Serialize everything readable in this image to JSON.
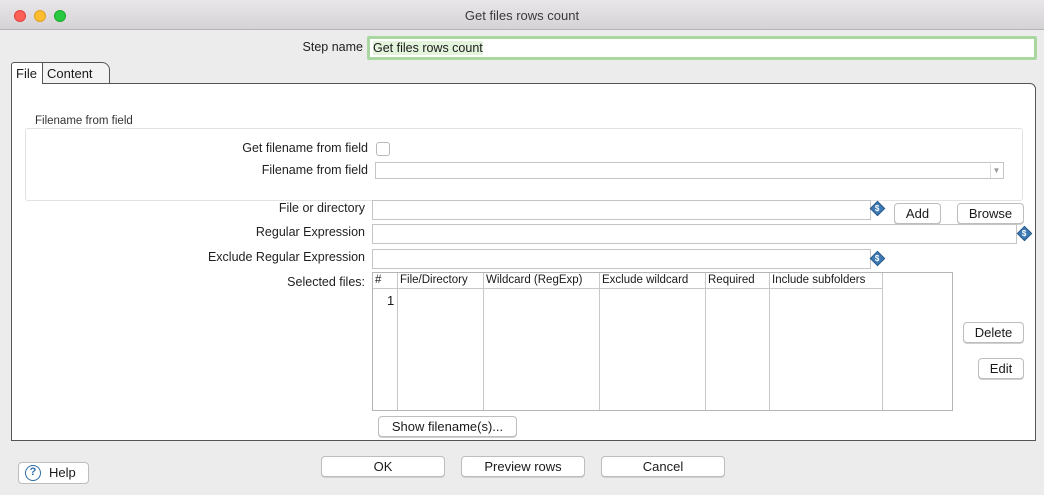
{
  "window": {
    "title": "Get files rows count"
  },
  "step": {
    "label": "Step name",
    "value": "Get files rows count"
  },
  "tabs": [
    {
      "label": "File"
    },
    {
      "label": "Content"
    }
  ],
  "filename_from_field": {
    "group_title": "Filename from field",
    "get_filename_label": "Get filename from field",
    "get_filename_checked": false,
    "filename_field_label": "Filename from field",
    "filename_field_value": ""
  },
  "file": {
    "file_or_directory_label": "File or directory",
    "file_or_directory_value": "",
    "regex_label": "Regular Expression",
    "regex_value": "",
    "exclude_regex_label": "Exclude Regular Expression",
    "exclude_regex_value": "",
    "add_label": "Add",
    "browse_label": "Browse",
    "variable_icon_glyph": "$"
  },
  "selected_files": {
    "label": "Selected files:",
    "columns": [
      "#",
      "File/Directory",
      "Wildcard (RegExp)",
      "Exclude wildcard",
      "Required",
      "Include subfolders"
    ],
    "rows": [
      {
        "num": "1"
      }
    ],
    "delete_label": "Delete",
    "edit_label": "Edit",
    "show_filenames_label": "Show filename(s)..."
  },
  "footer": {
    "help_label": "Help",
    "help_glyph": "?",
    "ok_label": "OK",
    "preview_label": "Preview rows",
    "cancel_label": "Cancel"
  },
  "colors": {
    "step_name_border": "#a8d8a0",
    "variable_icon": "#3d7ab5",
    "help_icon": "#2d6ba8"
  }
}
